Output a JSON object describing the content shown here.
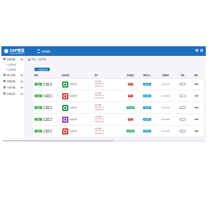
{
  "header": {
    "logo_title": "SAP管理",
    "logo_subtitle": "智慧商店运营管理平台",
    "menu_label": "列表管理"
  },
  "sidebar": {
    "items": [
      {
        "label": "应用管理",
        "icon": "app-icon"
      },
      {
        "label": "用户管理",
        "icon": "user-icon"
      },
      {
        "label": "权限管理",
        "icon": "lock-icon"
      },
      {
        "label": "日志管理",
        "icon": "log-icon"
      },
      {
        "label": "系统设置",
        "icon": "gear-icon"
      }
    ],
    "subitems": [
      "应用列表",
      "应用分类"
    ]
  },
  "breadcrumb": {
    "home": "首页",
    "current": "应用管理"
  },
  "toolbar": {
    "add_label": "+ 添加新应用"
  },
  "table": {
    "headers": [
      "操作",
      "应用名称",
      "简介",
      "应用格式",
      "更新方式",
      "当前版本",
      "状态",
      "操作"
    ],
    "rows": [
      {
        "edit": "编辑",
        "del": "删除",
        "name": "应用名称",
        "icon_color": "#2e9d57",
        "meta": [
          "0.00 MB",
          "2019-01-01",
          "2019-05-06"
        ],
        "fmt": "APK",
        "fmt_color": "#d9534f",
        "upd": "自动更新",
        "upd_color": "#20a3c8",
        "ver": "1.0.0.100"
      },
      {
        "edit": "编辑",
        "del": "删除",
        "name": "应用名称",
        "icon_color": "#d83b3b",
        "meta": [
          "0.00 MB",
          "2019-01-01",
          "2019-05-06"
        ],
        "fmt": "APK",
        "fmt_color": "#d9534f",
        "upd": "自动更新",
        "upd_color": "#20a3c8",
        "ver": "1.0.0.100"
      },
      {
        "edit": "编辑",
        "del": "删除",
        "name": "应用名称",
        "icon_color": "#2e9d57",
        "meta": [
          "0.00 MB",
          "2019-01-01",
          "2019-05-06"
        ],
        "fmt": "WEB应用",
        "fmt_color": "#3cb371",
        "upd": "自动更新",
        "upd_color": "#20a3c8",
        "ver": "1.0.0.100"
      },
      {
        "edit": "编辑",
        "del": "删除",
        "name": "应用名称",
        "icon_color": "#8e44ad",
        "meta": [
          "0.00 MB",
          "2019-01-01",
          "2019-05-06"
        ],
        "fmt": "APK",
        "fmt_color": "#d9534f",
        "upd": "自动更新",
        "upd_color": "#20a3c8",
        "ver": "1.0.0.100"
      },
      {
        "edit": "编辑",
        "del": "删除",
        "name": "应用名称",
        "icon_color": "#d83b3b",
        "meta": [
          "0.00 MB",
          "2019-01-01",
          "2019-05-06"
        ],
        "fmt": "WEB应用",
        "fmt_color": "#3cb371",
        "upd": "自动更新",
        "upd_color": "#20a3c8",
        "ver": "1.0.0.100"
      }
    ]
  },
  "colors": {
    "brand": "#1f6fbf",
    "edit": "#4caf50"
  }
}
